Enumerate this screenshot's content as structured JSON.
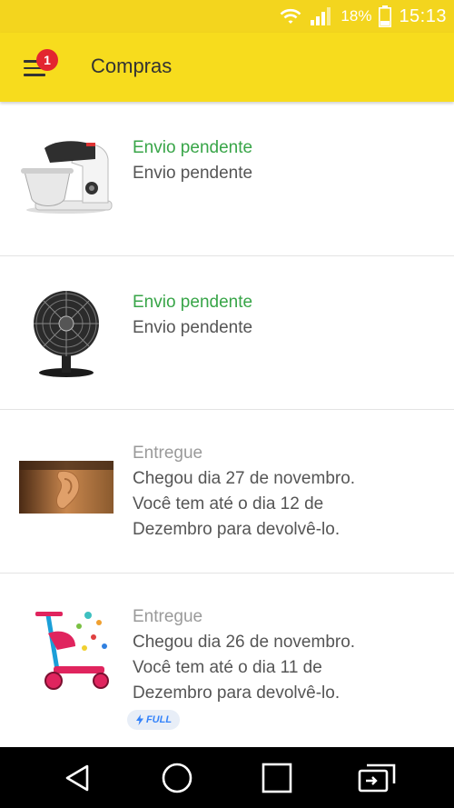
{
  "status_bar": {
    "battery_percent": "18%",
    "time": "15:13",
    "icons": [
      "wifi-icon",
      "signal-icon",
      "battery-icon"
    ]
  },
  "app_bar": {
    "title": "Compras",
    "menu_badge": "1"
  },
  "purchases": [
    {
      "image": "stand-mixer",
      "status": "Envio pendente",
      "status_color": "#38a548",
      "description": "Envio pendente"
    },
    {
      "image": "table-fan",
      "status": "Envio pendente",
      "status_color": "#38a548",
      "description": "Envio pendente"
    },
    {
      "image": "ear-photo",
      "status": "Entregue",
      "status_color": "#9a9a9a",
      "description_lines": [
        "Chegou dia 27 de novembro.",
        "Você tem até o dia 12 de",
        "Dezembro para devolvê-lo."
      ]
    },
    {
      "image": "kids-scooter",
      "status": "Entregue",
      "status_color": "#9a9a9a",
      "description_lines": [
        "Chegou dia 26 de novembro.",
        "Você tem até o dia 11 de",
        "Dezembro para devolvê-lo."
      ],
      "badge": "FULL"
    }
  ],
  "nav_bar": {
    "buttons": [
      "back-icon",
      "home-icon",
      "recents-icon",
      "switch-app-icon"
    ]
  },
  "colors": {
    "app_bar": "#f7dc1d",
    "status_bar": "#f3d51e",
    "badge_red": "#e3262f",
    "pending_green": "#38a548",
    "full_blue": "#3483fa"
  }
}
